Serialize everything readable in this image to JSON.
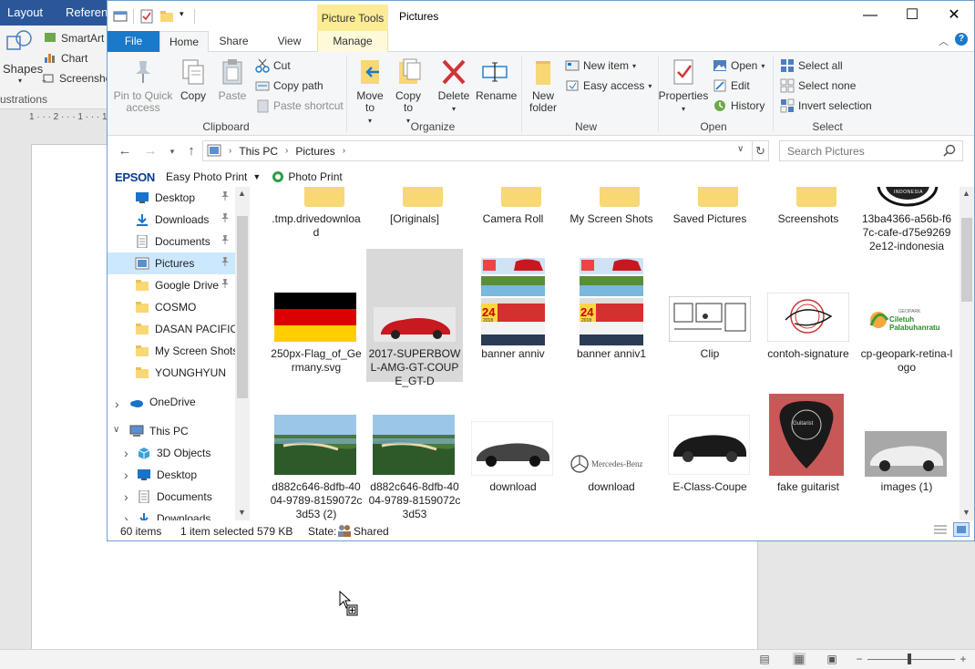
{
  "word": {
    "tabs": [
      "Layout",
      "Referenc"
    ],
    "ribbon": {
      "shapes_label": "Shapes",
      "smartart_label": "SmartArt",
      "chart_label": "Chart",
      "screenshot_label": "Screensho",
      "group_label": "ustrations"
    },
    "ruler_text": "1 · · · 2 · · · 1 · · · 1"
  },
  "explorer": {
    "title": "Pictures",
    "picture_tools": "Picture Tools",
    "tabs": {
      "file": "File",
      "home": "Home",
      "share": "Share",
      "view": "View",
      "manage": "Manage"
    },
    "ribbon": {
      "clipboard": {
        "label": "Clipboard",
        "pin": "Pin to Quick access",
        "copy": "Copy",
        "paste": "Paste",
        "cut": "Cut",
        "copy_path": "Copy path",
        "paste_shortcut": "Paste shortcut"
      },
      "organize": {
        "label": "Organize",
        "move_to": "Move to",
        "copy_to": "Copy to",
        "delete": "Delete",
        "rename": "Rename"
      },
      "new": {
        "label": "New",
        "new_folder": "New folder",
        "new_item": "New item",
        "easy_access": "Easy access"
      },
      "open": {
        "label": "Open",
        "properties": "Properties",
        "open": "Open",
        "edit": "Edit",
        "history": "History"
      },
      "select": {
        "label": "Select",
        "select_all": "Select all",
        "select_none": "Select none",
        "invert_selection": "Invert selection"
      }
    },
    "address": {
      "crumbs": [
        "This PC",
        "Pictures"
      ],
      "search_placeholder": "Search Pictures"
    },
    "epson": {
      "logo": "EPSON",
      "easy_photo_print": "Easy Photo Print",
      "photo_print": "Photo Print"
    },
    "nav": {
      "quick": [
        {
          "label": "Desktop",
          "icon": "desktop-icon",
          "pinned": true
        },
        {
          "label": "Downloads",
          "icon": "download-arrow-icon",
          "pinned": true
        },
        {
          "label": "Documents",
          "icon": "document-icon",
          "pinned": true
        },
        {
          "label": "Pictures",
          "icon": "pictures-icon",
          "pinned": true
        },
        {
          "label": "Google Drive",
          "icon": "folder-icon",
          "pinned": true
        },
        {
          "label": "COSMO",
          "icon": "folder-icon",
          "pinned": false
        },
        {
          "label": "DASAN PACIFIC",
          "icon": "folder-icon",
          "pinned": false
        },
        {
          "label": "My Screen Shots",
          "icon": "folder-icon",
          "pinned": false
        },
        {
          "label": "YOUNGHYUN",
          "icon": "folder-icon",
          "pinned": false
        }
      ],
      "onedrive": "OneDrive",
      "thispc": "This PC",
      "thispc_children": [
        "3D Objects",
        "Desktop",
        "Documents",
        "Downloads"
      ]
    },
    "files_row1": [
      ".tmp.drivedownload",
      "[Originals]",
      "Camera Roll",
      "My Screen Shots",
      "Saved Pictures",
      "Screenshots",
      "13ba4366-a56b-f67c-cafe-d75e92692e12-indonesia"
    ],
    "files_row2": [
      "250px-Flag_of_Germany.svg",
      "2017-SUPERBOWL-AMG-GT-COUPE_GT-D",
      "banner anniv",
      "banner anniv1",
      "Clip",
      "contoh-signature",
      "cp-geopark-retina-logo"
    ],
    "files_row3": [
      "d882c646-8dfb-4004-9789-8159072c3d53 (2)",
      "d882c646-8dfb-4004-9789-8159072c3d53",
      "download",
      "download",
      "E-Class-Coupe",
      "fake guitarist",
      "images (1)"
    ],
    "thumb_text": {
      "indonesia": "INDONESIA",
      "banner_day": "24",
      "banner_year": "2018",
      "geopark_small": "GEOPARK",
      "geopark_main": "Ciletuh Palabuhanratu",
      "mercedes": "Mercedes-Benz",
      "pick": "Guitarist"
    },
    "status": {
      "items": "60 items",
      "selected": "1 item selected",
      "size": "579 KB",
      "state_label": "State:",
      "state_value": "Shared"
    }
  }
}
